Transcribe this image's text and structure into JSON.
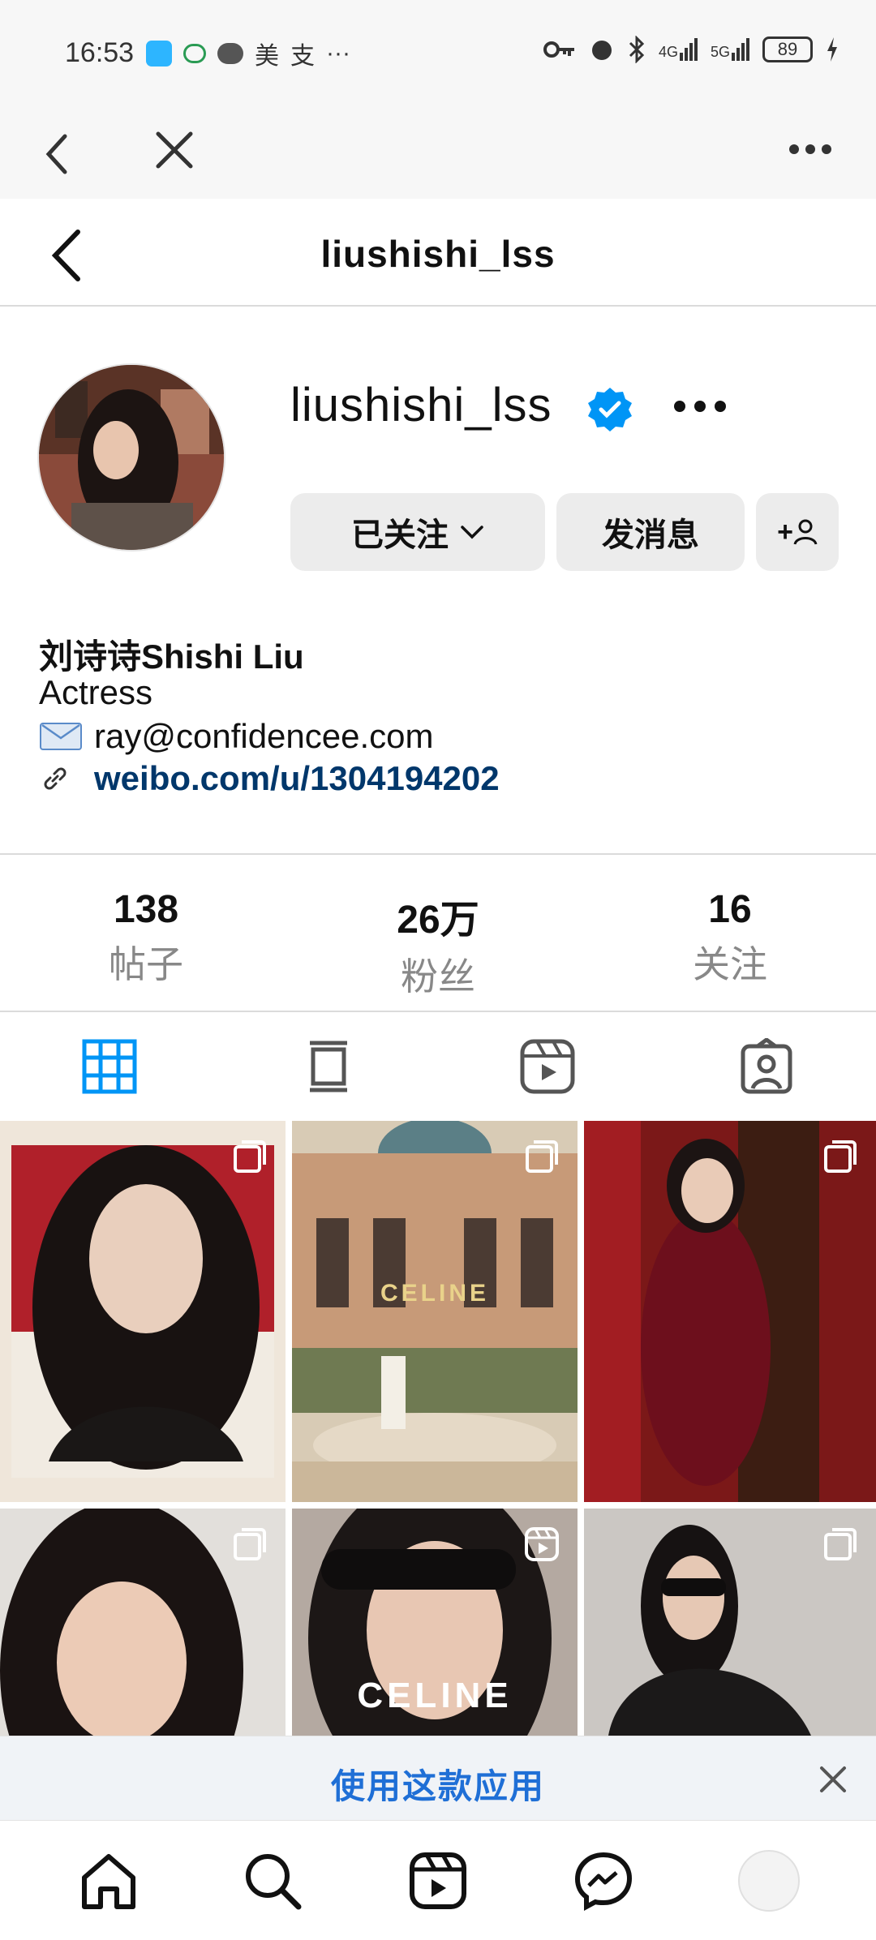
{
  "status_bar": {
    "time": "16:53",
    "app_badges": [
      "美",
      "支",
      "···"
    ],
    "network_1": "4G",
    "network_2": "5G",
    "battery": "89"
  },
  "browser": {
    "back_icon": "chevron-left-icon",
    "close_icon": "close-icon",
    "more_icon": "more-dots-icon"
  },
  "header": {
    "title": "liushishi_lss"
  },
  "profile": {
    "username": "liushishi_lss",
    "verified": true,
    "follow_button": "已关注",
    "message_button": "发消息",
    "add_user_button": "+"
  },
  "bio": {
    "full_name": "刘诗诗Shishi Liu",
    "category": "Actress",
    "email": "ray@confidencee.com",
    "link": "weibo.com/u/1304194202"
  },
  "stats": [
    {
      "value": "138",
      "label": "帖子"
    },
    {
      "value": "26万",
      "label": "粉丝"
    },
    {
      "value": "16",
      "label": "关注"
    }
  ],
  "grid_posts": [
    {
      "type": "carousel",
      "caption": ""
    },
    {
      "type": "carousel",
      "caption": "CELINE"
    },
    {
      "type": "carousel",
      "caption": ""
    },
    {
      "type": "carousel",
      "caption": ""
    },
    {
      "type": "reel",
      "caption": "CELINE"
    },
    {
      "type": "carousel",
      "caption": ""
    }
  ],
  "banner": {
    "text": "使用这款应用"
  },
  "colors": {
    "accent": "#0095f6",
    "link": "#00376b",
    "banner_text": "#1f6fd6",
    "button_bg": "#ececec"
  }
}
